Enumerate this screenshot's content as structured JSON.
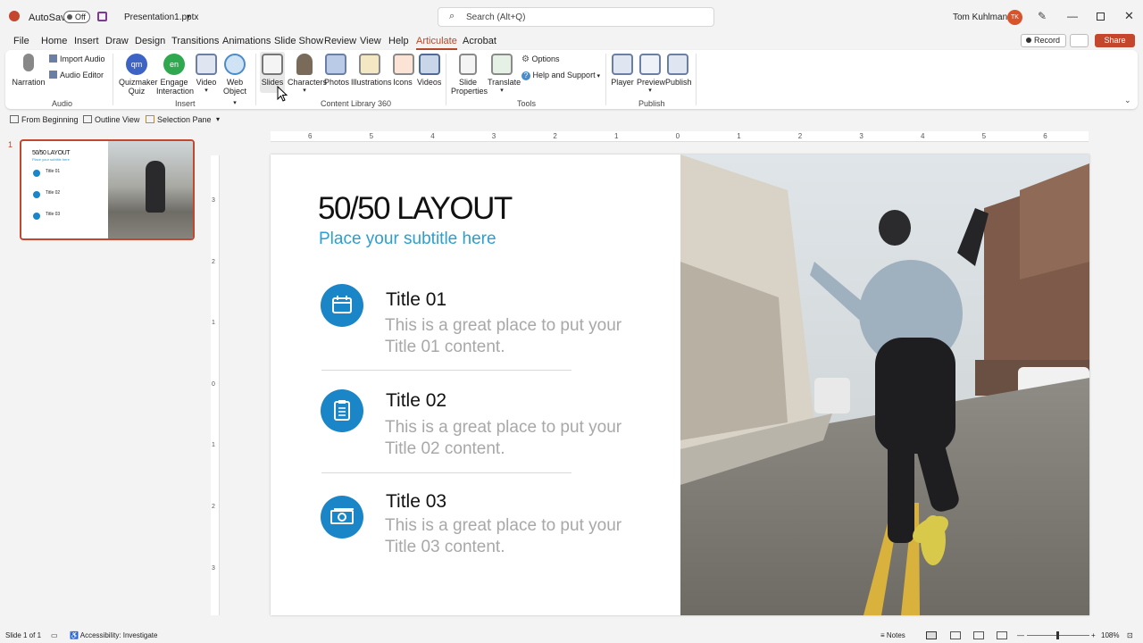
{
  "titlebar": {
    "autosave_label": "AutoSave",
    "autosave_state": "Off",
    "filename": "Presentation1.pptx",
    "search_placeholder": "Search (Alt+Q)",
    "user_name": "Tom Kuhlmann",
    "user_initials": "TK"
  },
  "menu": {
    "tabs": [
      "File",
      "Home",
      "Insert",
      "Draw",
      "Design",
      "Transitions",
      "Animations",
      "Slide Show",
      "Review",
      "View",
      "Help",
      "Articulate",
      "Acrobat"
    ],
    "active_tab": "Articulate",
    "record_label": "Record",
    "share_label": "Share"
  },
  "ribbon": {
    "narration": "Narration",
    "import_audio": "Import Audio",
    "audio_editor": "Audio Editor",
    "group_audio": "Audio",
    "quizmaker_line1": "Quizmaker",
    "quizmaker_line2": "Quiz",
    "quizmaker_badge": "qm",
    "engage_line1": "Engage",
    "engage_line2": "Interaction",
    "engage_badge": "en",
    "video": "Video",
    "web_object_line1": "Web",
    "web_object_line2": "Object",
    "group_insert": "Insert",
    "slides": "Slides",
    "characters": "Characters",
    "photos": "Photos",
    "illustrations": "Illustrations",
    "icons": "Icons",
    "videos": "Videos",
    "group_content_library": "Content Library 360",
    "slide_properties_line1": "Slide",
    "slide_properties_line2": "Properties",
    "translate": "Translate",
    "options": "Options",
    "help_support": "Help and Support",
    "group_tools": "Tools",
    "player": "Player",
    "preview": "Preview",
    "publish": "Publish",
    "group_publish": "Publish"
  },
  "quickbar": {
    "from_beginning": "From Beginning",
    "outline_view": "Outline View",
    "selection_pane": "Selection Pane"
  },
  "thumbnail": {
    "number": "1",
    "title": "50/50 LAYOUT",
    "subtitle": "Place your subtitle here",
    "items": [
      "Title 01",
      "Title 02",
      "Title 03"
    ]
  },
  "ruler": {
    "h_labels": [
      "6",
      "5",
      "4",
      "3",
      "2",
      "1",
      "0",
      "1",
      "2",
      "3",
      "4",
      "5",
      "6"
    ],
    "v_labels": [
      "3",
      "2",
      "1",
      "0",
      "1",
      "2",
      "3"
    ]
  },
  "slide": {
    "title": "50/50 LAYOUT",
    "subtitle": "Place your subtitle here",
    "items": [
      {
        "title": "Title 01",
        "line1": "This is a great place to put your",
        "line2": "Title 01 content.",
        "icon": "calendar-icon"
      },
      {
        "title": "Title 02",
        "line1": "This is a great place to put your",
        "line2": "Title 02 content.",
        "icon": "clipboard-icon"
      },
      {
        "title": "Title 03",
        "line1": "This is a great place to put your",
        "line2": "Title 03 content.",
        "icon": "money-icon"
      }
    ],
    "accent_color": "#1a85c7",
    "subtitle_color": "#2a9fd0"
  },
  "status": {
    "slide_count": "Slide 1 of 1",
    "accessibility": "Accessibility: Investigate",
    "notes": "Notes",
    "zoom": "108%"
  }
}
